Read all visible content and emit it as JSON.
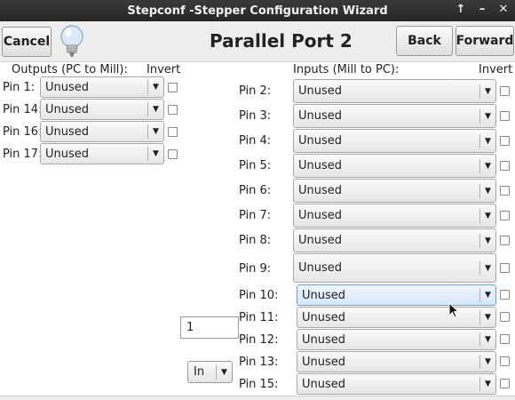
{
  "window": {
    "title": "Stepconf -Stepper Configuration Wizard",
    "controls": [
      "↑",
      "–",
      "✕"
    ]
  },
  "header": {
    "cancel": "Cancel",
    "title": "Parallel Port 2",
    "back": "Back",
    "forward": "Forward",
    "icon": "lightbulb-icon"
  },
  "outputs": {
    "heading": "Outputs (PC to Mill):",
    "invert_heading": "Invert",
    "rows": [
      {
        "label": "Pin 1:",
        "value": "Unused"
      },
      {
        "label": "Pin 14:",
        "value": "Unused"
      },
      {
        "label": "Pin 16:",
        "value": "Unused"
      },
      {
        "label": "Pin 17:",
        "value": "Unused"
      }
    ]
  },
  "inputs": {
    "heading": "Inputs (Mill to PC):",
    "invert_heading": "Invert",
    "rows": [
      {
        "label": "Pin 2:",
        "value": "Unused"
      },
      {
        "label": "Pin 3:",
        "value": "Unused"
      },
      {
        "label": "Pin 4:",
        "value": "Unused"
      },
      {
        "label": "Pin 5:",
        "value": "Unused"
      },
      {
        "label": "Pin 6:",
        "value": "Unused"
      },
      {
        "label": "Pin 7:",
        "value": "Unused"
      },
      {
        "label": "Pin 8:",
        "value": "Unused"
      },
      {
        "label": "Pin 9:",
        "value": "Unused"
      },
      {
        "label": "Pin 10:",
        "value": "Unused"
      },
      {
        "label": "Pin 11:",
        "value": "Unused"
      },
      {
        "label": "Pin 12:",
        "value": "Unused"
      },
      {
        "label": "Pin 13:",
        "value": "Unused"
      },
      {
        "label": "Pin 15:",
        "value": "Unused"
      }
    ]
  },
  "port_address": {
    "value": "1"
  },
  "direction": {
    "value": "In"
  },
  "colors": {
    "titlebar": "#2e2e2e",
    "selection": "#6a9fd9"
  }
}
